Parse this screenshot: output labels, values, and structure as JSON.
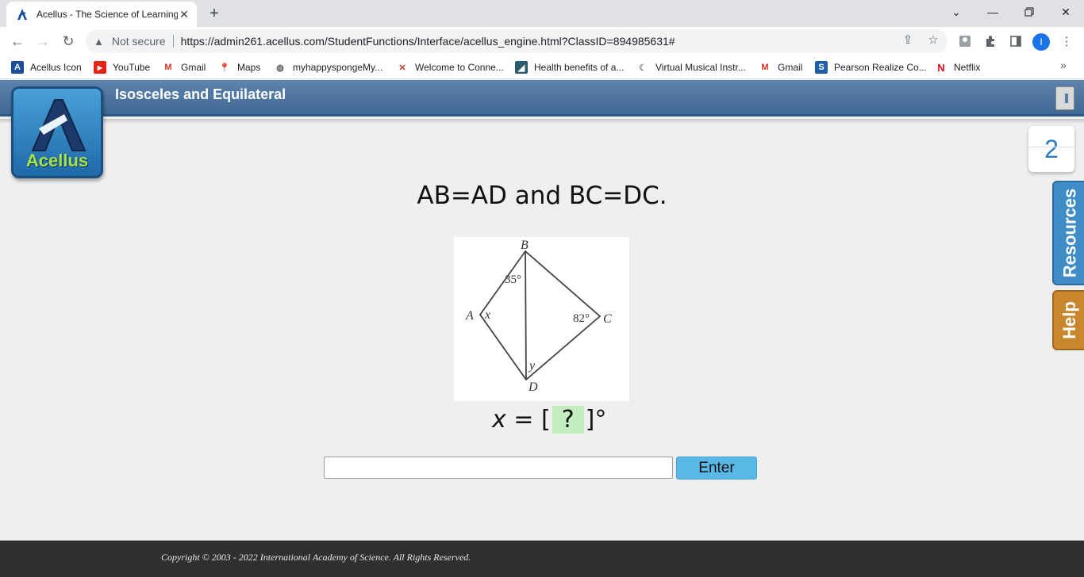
{
  "browser": {
    "tab_title": "Acellus - The Science of Learning",
    "omnibox": {
      "security_label": "Not secure",
      "url": "https://admin261.acellus.com/StudentFunctions/Interface/acellus_engine.html?ClassID=894985631#"
    },
    "profile_initial": "I",
    "bookmarks": [
      {
        "label": "Acellus Icon",
        "icon": "acellus-icon"
      },
      {
        "label": "YouTube",
        "icon": "youtube-icon"
      },
      {
        "label": "Gmail",
        "icon": "gmail-icon"
      },
      {
        "label": "Maps",
        "icon": "maps-icon"
      },
      {
        "label": "myhappyspongeMy...",
        "icon": "globe-icon"
      },
      {
        "label": "Welcome to Conne...",
        "icon": "connexus-icon"
      },
      {
        "label": "Health benefits of a...",
        "icon": "article-icon"
      },
      {
        "label": "Virtual Musical Instr...",
        "icon": "moon-icon"
      },
      {
        "label": "Gmail",
        "icon": "gmail-icon"
      },
      {
        "label": "Pearson Realize Co...",
        "icon": "pearson-icon"
      },
      {
        "label": "Netflix",
        "icon": "netflix-icon"
      }
    ]
  },
  "acellus": {
    "lesson_title": "Isosceles and Equilateral",
    "logo_text": "Acellus",
    "problem_count": "2",
    "side_tabs": {
      "resources": "Resources",
      "help": "Help"
    },
    "problem": {
      "statement": "AB=AD and BC=DC.",
      "diagram_labels": {
        "a": "A",
        "b": "B",
        "c": "C",
        "d": "D",
        "x": "x",
        "y": "y",
        "angle_b": "35°",
        "angle_c": "82°"
      },
      "answer": {
        "variable": "x",
        "equals": " = ",
        "open": "[",
        "blank": "?",
        "close": "]",
        "unit": "°"
      }
    },
    "input_value": "",
    "enter_label": "Enter",
    "copyright": "Copyright © 2003 - 2022 International Academy of Science.  All Rights Reserved."
  },
  "colors": {
    "header_blue": "#4a729c",
    "enter_button": "#5ab8e6",
    "resources_tab": "#3f8cc6",
    "help_tab": "#c8872d",
    "answer_highlight": "#c3ecbf",
    "footer": "#2f2f2f"
  }
}
